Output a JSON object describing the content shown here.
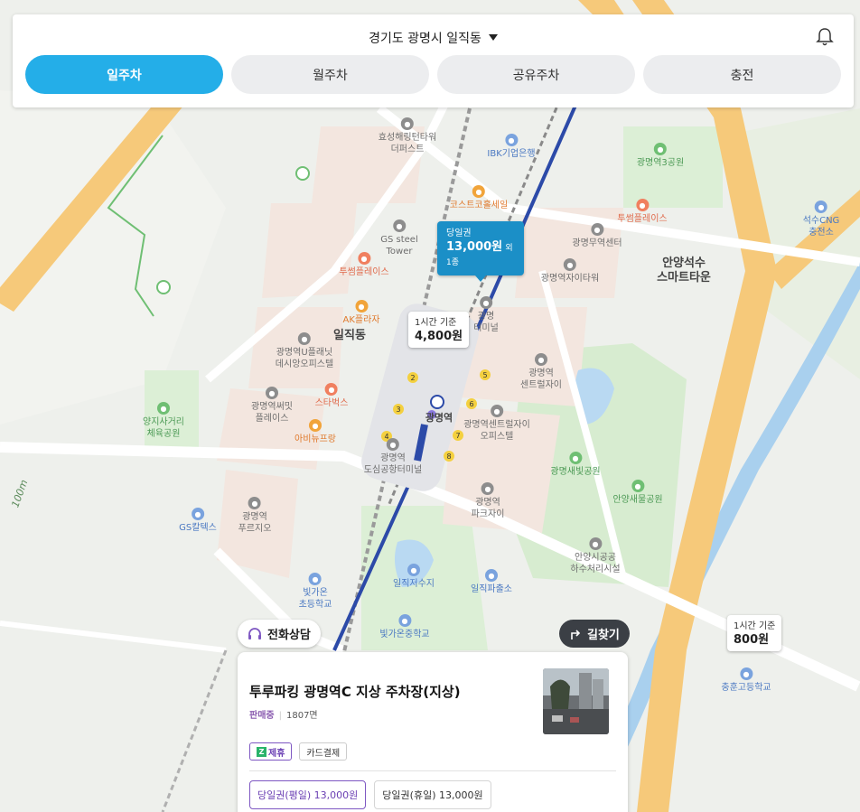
{
  "header": {
    "location": "경기도 광명시 일직동",
    "tabs": [
      {
        "label": "일주차",
        "active": true
      },
      {
        "label": "월주차",
        "active": false
      },
      {
        "label": "공유주차",
        "active": false
      },
      {
        "label": "충전",
        "active": false
      }
    ]
  },
  "map": {
    "area_labels": [
      "일직동",
      "안양석수\n스마트타운"
    ],
    "pois": [
      {
        "label": "효성해링턴타워\n더퍼스트",
        "color": "gray"
      },
      {
        "label": "IBK기업은행",
        "color": "blue"
      },
      {
        "label": "코스트코홀세일",
        "color": "orange"
      },
      {
        "label": "GS steel\nTower",
        "color": "gray"
      },
      {
        "label": "투썸플레이스",
        "color": "red"
      },
      {
        "label": "AK플라자",
        "color": "orange"
      },
      {
        "label": "광명역U플래닛\n데시앙오피스텔",
        "color": "gray"
      },
      {
        "label": "광명역써밋\n플레이스",
        "color": "gray"
      },
      {
        "label": "스타벅스",
        "color": "red"
      },
      {
        "label": "아비뉴프랑",
        "color": "orange"
      },
      {
        "label": "양지사거리\n체육공원",
        "color": "green"
      },
      {
        "label": "GS칼텍스",
        "color": "blue"
      },
      {
        "label": "광명역\n푸르지오",
        "color": "gray"
      },
      {
        "label": "빛가온\n초등학교",
        "color": "blue"
      },
      {
        "label": "일직저수지",
        "color": "blue"
      },
      {
        "label": "빛가온중학교",
        "color": "blue"
      },
      {
        "label": "일직파출소",
        "color": "blue"
      },
      {
        "label": "광명역3공원",
        "color": "green"
      },
      {
        "label": "투썸플레이스",
        "color": "red"
      },
      {
        "label": "광명무역센터",
        "color": "gray"
      },
      {
        "label": "광명역자이타워",
        "color": "gray"
      },
      {
        "label": "광명\n터미널",
        "color": "gray"
      },
      {
        "label": "광명역\n센트럴자이",
        "color": "gray"
      },
      {
        "label": "광명역센트럴자이\n오피스텔",
        "color": "gray"
      },
      {
        "label": "광명역\n도심공항터미널",
        "color": "gray"
      },
      {
        "label": "광명역\n파크자이",
        "color": "gray"
      },
      {
        "label": "광명새빛공원",
        "color": "green"
      },
      {
        "label": "안양새물공원",
        "color": "green"
      },
      {
        "label": "안양시공공\n하수처리시설",
        "color": "gray"
      },
      {
        "label": "석수CNG\n충전소",
        "color": "blue"
      },
      {
        "label": "충훈고등학교",
        "color": "blue"
      },
      {
        "label": "광명역",
        "color": "gray"
      }
    ],
    "road_label": "100m"
  },
  "bubbles": {
    "main": {
      "label": "당일권",
      "price": "13,000원",
      "extra": "외 1종"
    },
    "hourly1": {
      "label": "1시간 기준",
      "price": "4,800원"
    },
    "hourly2": {
      "label": "1시간 기준",
      "price": "800원"
    }
  },
  "buttons": {
    "consult": "전화상담",
    "directions": "길찾기"
  },
  "card": {
    "title": "투루파킹 광명역C 지상 주차장(지상)",
    "status": "판매중",
    "spaces": "1807면",
    "tags": [
      "제휴",
      "카드결제"
    ],
    "prices": [
      {
        "label": "당일권(평일) 13,000원",
        "active": true
      },
      {
        "label": "당일권(휴일) 13,000원",
        "active": false
      }
    ]
  },
  "colors": {
    "accent": "#24aee8",
    "bubble": "#1b8fc7",
    "partner": "#7e57c2"
  }
}
